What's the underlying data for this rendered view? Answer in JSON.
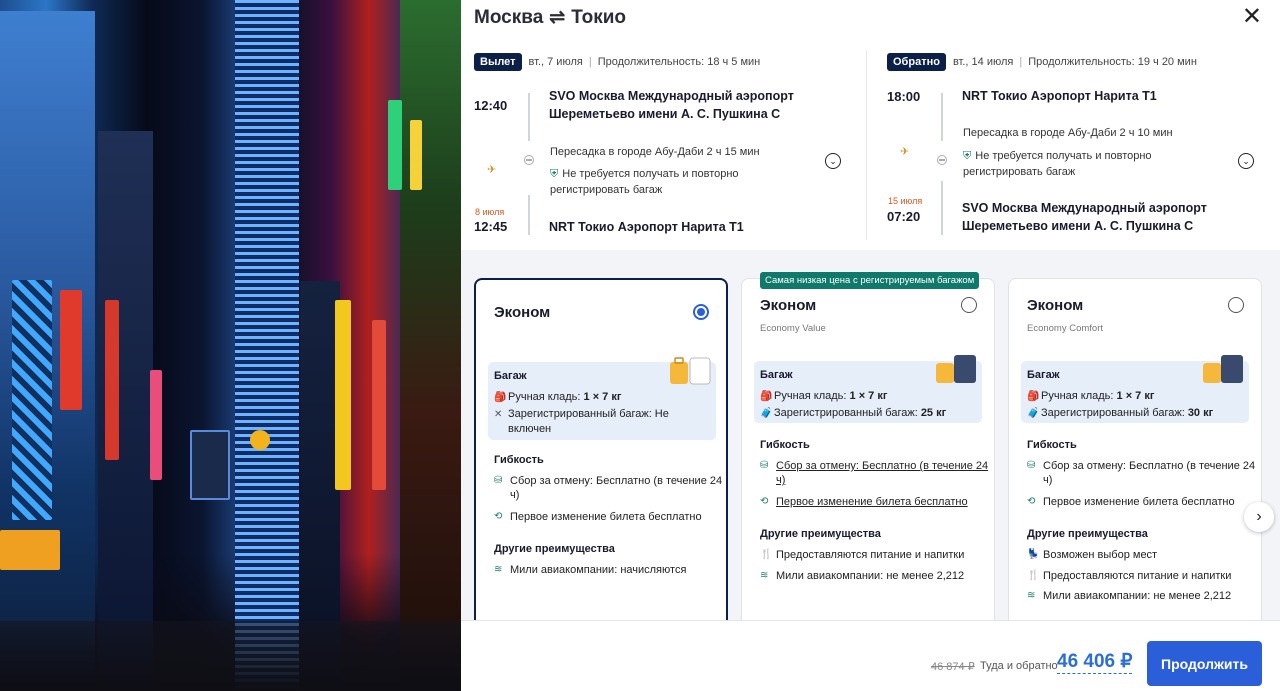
{
  "title": {
    "from": "Москва",
    "to": "Токио",
    "swap_glyph": "⇌"
  },
  "outbound": {
    "tag": "Вылет",
    "date": "вт., 7 июля",
    "duration": "Продолжительность: 18 ч 5 мин",
    "dep_time": "12:40",
    "dep_airport": "SVO Москва Международный аэропорт Шереметьево имени А. С. Пушкина C",
    "transfer": "Пересадка в городе Абу-Даби  2 ч 15 мин",
    "baggage_note": "Не требуется получать и повторно регистрировать багаж",
    "arr_date": "8 июля",
    "arr_time": "12:45",
    "arr_airport": "NRT Токио Аэропорт Нарита T1"
  },
  "return": {
    "tag": "Обратно",
    "date": "вт., 14 июля",
    "duration": "Продолжительность: 19 ч 20 мин",
    "dep_time": "18:00",
    "dep_airport": "NRT Токио Аэропорт Нарита T1",
    "transfer": "Пересадка в городе Абу-Даби  2 ч 10 мин",
    "baggage_note": "Не требуется получать и повторно регистрировать багаж",
    "arr_date": "15 июля",
    "arr_time": "07:20",
    "arr_airport": "SVO Москва Международный аэропорт Шереметьево имени А. С. Пушкина C"
  },
  "fares": [
    {
      "name": "Эконом",
      "subtitle": "",
      "selected": true,
      "badge": "",
      "baggage_title": "Багаж",
      "hand": "Ручная кладь: ",
      "hand_val": "1 × 7 кг",
      "checked": "Зарегистрированный багаж: Не включен",
      "checked_val": "",
      "flex_title": "Гибкость",
      "flex": [
        "Сбор за отмену: Бесплатно (в течение 24 ч)",
        "Первое изменение билета бесплатно"
      ],
      "other_title": "Другие преимущества",
      "other": [
        "Мили авиакомпании: начисляются"
      ]
    },
    {
      "name": "Эконом",
      "subtitle": "Economy Value",
      "selected": false,
      "badge": "Самая низкая цена с регистрируемым багажом",
      "baggage_title": "Багаж",
      "hand": "Ручная кладь: ",
      "hand_val": "1 × 7 кг",
      "checked": "Зарегистрированный багаж: ",
      "checked_val": "25 кг",
      "flex_title": "Гибкость",
      "flex": [
        "Сбор за отмену: Бесплатно (в течение 24 ч)",
        "Первое изменение билета бесплатно"
      ],
      "other_title": "Другие преимущества",
      "other": [
        "Предоставляются питание и напитки",
        "Мили авиакомпании: не менее 2,212"
      ]
    },
    {
      "name": "Эконом",
      "subtitle": "Economy Comfort",
      "selected": false,
      "badge": "",
      "baggage_title": "Багаж",
      "hand": "Ручная кладь: ",
      "hand_val": "1 × 7 кг",
      "checked": "Зарегистрированный багаж: ",
      "checked_val": "30 кг",
      "flex_title": "Гибкость",
      "flex": [
        "Сбор за отмену: Бесплатно (в течение 24 ч)",
        "Первое изменение билета бесплатно"
      ],
      "other_title": "Другие преимущества",
      "other": [
        "Возможен выбор мест",
        "Предоставляются питание и напитки",
        "Мили авиакомпании: не менее 2,212"
      ]
    }
  ],
  "footer": {
    "old_price": "46 874 ₽",
    "round_trip": "Туда и обратно",
    "price": "46 406 ₽",
    "continue": "Продолжить"
  },
  "icons": {
    "close": "close-icon",
    "next": "chevron-right-icon",
    "expand": "chevron-down-icon"
  },
  "colors": {
    "accent": "#2b5fd9",
    "dark": "#0b1f47",
    "badge": "#0f7a6b",
    "price": "#2b6fd6"
  }
}
